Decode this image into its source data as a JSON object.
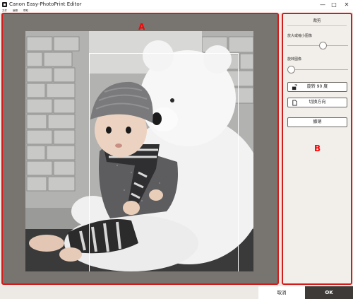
{
  "window": {
    "title": "Canon Easy-PhotoPrint Editor",
    "minimize_icon": "minimize-icon",
    "maximize_icon": "maximize-icon",
    "close_icon": "close-icon"
  },
  "menu": {
    "items": [
      "文件",
      "编辑",
      "帮助"
    ]
  },
  "annotations": {
    "a": "A",
    "b": "B"
  },
  "panel": {
    "title": "裁剪",
    "zoom_label": "放大或缩小图像",
    "zoom_value": 0.6,
    "rotate_label": "旋转图像",
    "rotate_value": 0.0,
    "rotate90_label": "旋转 90 度",
    "orientation_label": "切换方向",
    "undo_label": "撤销"
  },
  "footer": {
    "cancel_label": "取消",
    "ok_label": "OK"
  },
  "colors": {
    "highlight": "#d21c1c",
    "marker": "#ff0000",
    "ok_bg": "#3d3a37"
  }
}
